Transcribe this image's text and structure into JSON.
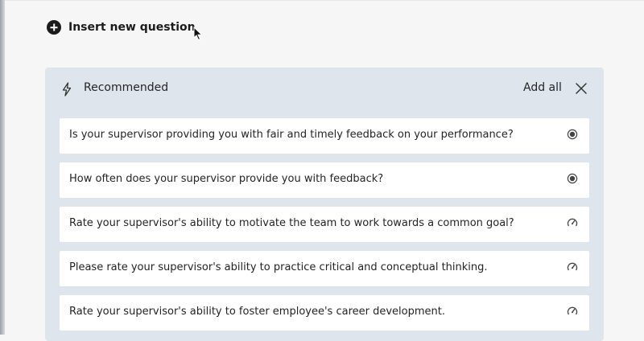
{
  "insert": {
    "label": "Insert new question",
    "icon": "plus-circle-icon"
  },
  "recommended": {
    "title": "Recommended",
    "title_icon": "lightning-bolt-icon",
    "add_all_label": "Add all",
    "close_icon": "close-icon",
    "background_color": "#dfe5ec",
    "questions": [
      {
        "text": "Is your supervisor providing you with fair and timely feedback on your performance?",
        "type_icon": "radio-choice-icon"
      },
      {
        "text": "How often does your supervisor provide you with feedback?",
        "type_icon": "radio-choice-icon"
      },
      {
        "text": "Rate your supervisor's ability to motivate the team to work towards a common goal?",
        "type_icon": "gauge-rating-icon"
      },
      {
        "text": "Please rate your supervisor's ability to practice critical and conceptual thinking.",
        "type_icon": "gauge-rating-icon"
      },
      {
        "text": "Rate your supervisor's ability to foster employee's career development.",
        "type_icon": "gauge-rating-icon"
      }
    ]
  }
}
